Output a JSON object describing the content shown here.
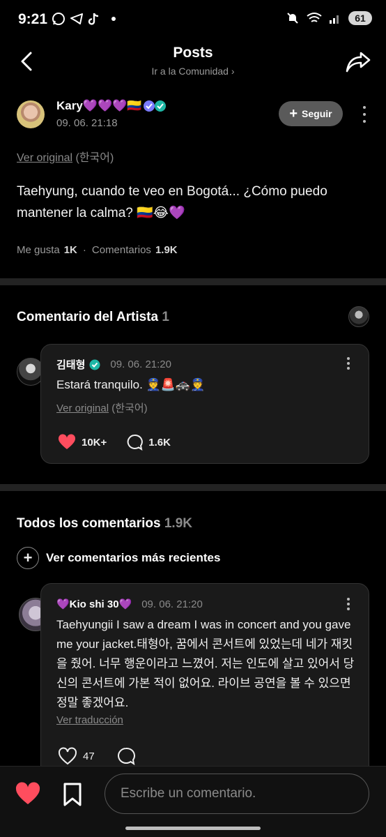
{
  "status_bar": {
    "time": "9:21",
    "battery": "61",
    "icons": [
      "whatsapp-icon",
      "telegram-icon",
      "tiktok-icon",
      "dot-icon",
      "mute-icon",
      "wifi-icon",
      "signal-icon",
      "battery-icon"
    ]
  },
  "header": {
    "title": "Posts",
    "subtitle": "Ir a la Comunidad ›",
    "back_icon": "back-icon",
    "share_icon": "share-icon"
  },
  "post": {
    "author_name": "Kary💜💜💜🇨🇴",
    "date": "09. 06. 21:18",
    "follow_label": "Seguir",
    "original_link": "Ver original",
    "original_lang": "(한국어)",
    "text": "Taehyung, cuando te veo en Bogotá... ¿Cómo puedo mantener la calma? 🇨🇴😂💜",
    "likes_label": "Me gusta",
    "likes_count": "1K",
    "separator": "·",
    "comments_label": "Comentarios",
    "comments_count": "1.9K"
  },
  "artist_section": {
    "title": "Comentario del Artista",
    "count": "1",
    "comment": {
      "name": "김태형",
      "date": "09. 06. 21:20",
      "text": "Estará tranquilo. 👮🚨🚓👮",
      "original_link": "Ver original",
      "original_lang": "(한국어)",
      "likes": "10K+",
      "replies": "1.6K"
    }
  },
  "all_comments": {
    "title": "Todos los comentarios",
    "count": "1.9K",
    "see_recent": "Ver comentarios más recientes",
    "comment": {
      "name": "💜Kio shi 30💜",
      "date": "09. 06. 21:20",
      "text": "Taehyungii I saw a dream I was in concert and you gave me your jacket.태형아, 꿈에서 콘서트에 있었는데 네가 재킷을 줬어. 너무 행운이라고 느꼈어. 저는 인도에 살고 있어서 당신의 콘서트에 가본 적이 없어요. 라이브 공연을 볼 수 있으면 정말 좋겠어요.",
      "translate_link": "Ver traducción",
      "likes": "47"
    }
  },
  "bottom_bar": {
    "input_placeholder": "Escribe un comentario."
  },
  "colors": {
    "background": "#000000",
    "card": "#1a1a1a",
    "like_red": "#ff4d5e",
    "verified_teal": "#1fb7a6",
    "muted_text": "#8a8a8a"
  }
}
